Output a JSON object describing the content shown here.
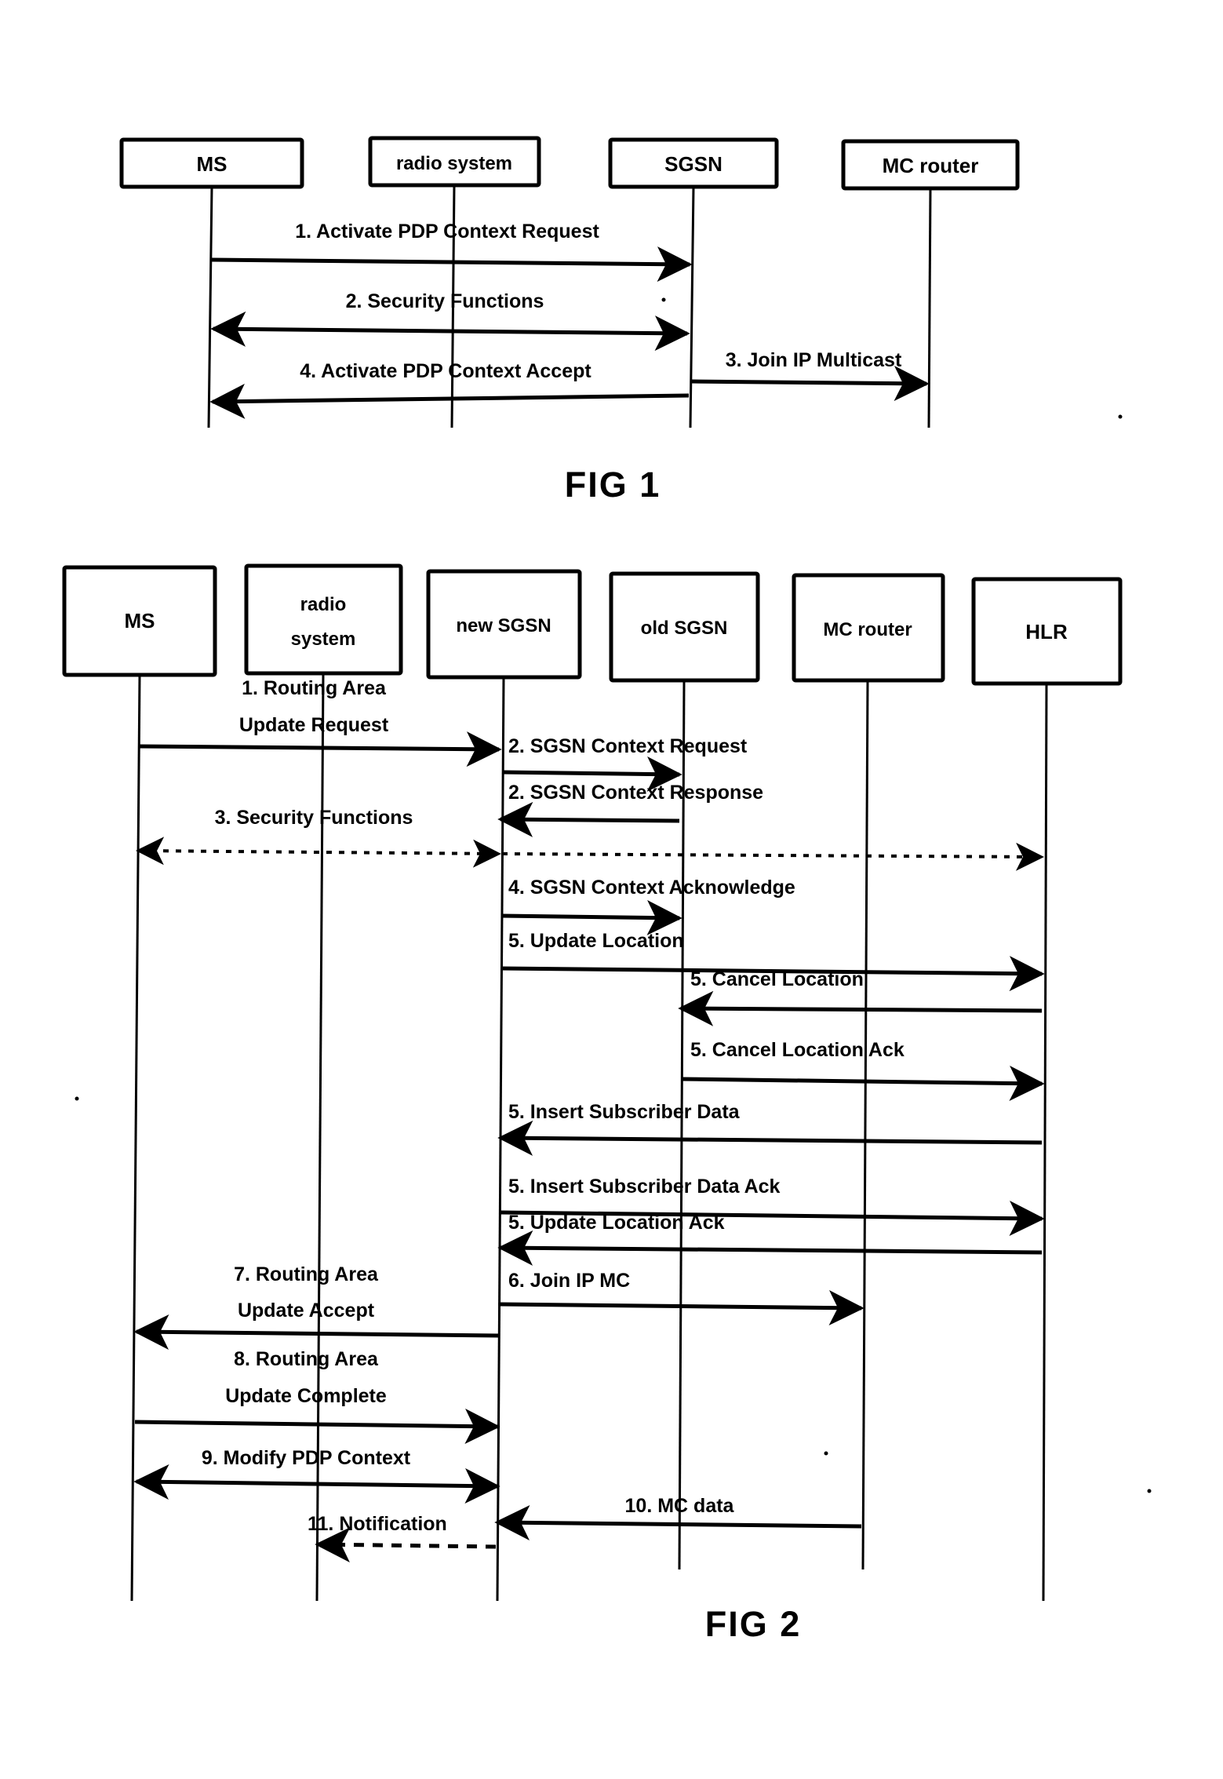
{
  "document": {
    "kind": "patent-sequence-diagrams",
    "figures": [
      {
        "id": "fig1",
        "caption": "FIG 1",
        "lanes": [
          {
            "key": "ms",
            "label": "MS"
          },
          {
            "key": "radio",
            "label": "radio system"
          },
          {
            "key": "sgsn",
            "label": "SGSN"
          },
          {
            "key": "mc_router",
            "label": "MC router"
          }
        ],
        "messages": [
          {
            "num": "1",
            "label": "1. Activate PDP Context Request",
            "from": "ms",
            "to": "sgsn",
            "style": "solid",
            "direction": "right"
          },
          {
            "num": "2",
            "label": "2. Security Functions",
            "from": "ms",
            "to": "sgsn",
            "style": "solid",
            "direction": "both"
          },
          {
            "num": "3",
            "label": "3. Join IP Multicast",
            "from": "sgsn",
            "to": "mc_router",
            "style": "solid",
            "direction": "right"
          },
          {
            "num": "4",
            "label": "4. Activate PDP Context Accept",
            "from": "sgsn",
            "to": "ms",
            "style": "solid",
            "direction": "left"
          }
        ]
      },
      {
        "id": "fig2",
        "caption": "FIG 2",
        "lanes": [
          {
            "key": "ms",
            "label": "MS"
          },
          {
            "key": "radio",
            "label": "radio\nsystem"
          },
          {
            "key": "new_sgsn",
            "label": "new SGSN"
          },
          {
            "key": "old_sgsn",
            "label": "old SGSN"
          },
          {
            "key": "mc_router",
            "label": "MC router"
          },
          {
            "key": "hlr",
            "label": "HLR"
          }
        ],
        "messages": [
          {
            "num": "1",
            "label": "1. Routing  Area\nUpdate Request",
            "from": "ms",
            "to": "new_sgsn",
            "style": "solid",
            "direction": "right"
          },
          {
            "num": "2a",
            "label": "2. SGSN Context Request",
            "from": "new_sgsn",
            "to": "old_sgsn",
            "style": "solid",
            "direction": "right"
          },
          {
            "num": "2b",
            "label": "2. SGSN Context Response",
            "from": "old_sgsn",
            "to": "new_sgsn",
            "style": "solid",
            "direction": "left"
          },
          {
            "num": "3",
            "label": "3. Security Functions",
            "from": "ms",
            "to": "hlr",
            "style": "dotted",
            "direction": "both"
          },
          {
            "num": "4",
            "label": "4. SGSN Context Acknowledge",
            "from": "new_sgsn",
            "to": "old_sgsn",
            "style": "solid",
            "direction": "right"
          },
          {
            "num": "5a",
            "label": "5. Update Location",
            "from": "new_sgsn",
            "to": "hlr",
            "style": "solid",
            "direction": "right"
          },
          {
            "num": "5b",
            "label": "5. Cancel Location",
            "from": "hlr",
            "to": "old_sgsn",
            "style": "solid",
            "direction": "left"
          },
          {
            "num": "5c",
            "label": "5. Cancel Location Ack",
            "from": "old_sgsn",
            "to": "hlr",
            "style": "solid",
            "direction": "right"
          },
          {
            "num": "5d",
            "label": "5. Insert Subscriber Data",
            "from": "hlr",
            "to": "new_sgsn",
            "style": "solid",
            "direction": "left"
          },
          {
            "num": "5e",
            "label": "5. Insert Subscriber Data Ack",
            "from": "new_sgsn",
            "to": "hlr",
            "style": "solid",
            "direction": "right"
          },
          {
            "num": "5f",
            "label": "5. Update Location Ack",
            "from": "hlr",
            "to": "new_sgsn",
            "style": "solid",
            "direction": "left"
          },
          {
            "num": "6",
            "label": "6. Join IP MC",
            "from": "new_sgsn",
            "to": "mc_router",
            "style": "solid",
            "direction": "right"
          },
          {
            "num": "7",
            "label": "7. Routing  Area\nUpdate Accept",
            "from": "new_sgsn",
            "to": "ms",
            "style": "solid",
            "direction": "left"
          },
          {
            "num": "8",
            "label": "8. Routing  Area\nUpdate Complete",
            "from": "ms",
            "to": "new_sgsn",
            "style": "solid",
            "direction": "right"
          },
          {
            "num": "9",
            "label": "9. Modify PDP Context",
            "from": "ms",
            "to": "new_sgsn",
            "style": "solid",
            "direction": "both"
          },
          {
            "num": "10",
            "label": "10. MC data",
            "from": "mc_router",
            "to": "new_sgsn",
            "style": "solid",
            "direction": "left"
          },
          {
            "num": "11",
            "label": "11. Notification",
            "from": "new_sgsn",
            "to": "radio",
            "style": "dashed",
            "direction": "left"
          }
        ]
      }
    ]
  },
  "fig1": {
    "caption": "FIG 1",
    "lanes": {
      "ms": "MS",
      "radio": "radio system",
      "sgsn": "SGSN",
      "mc_router": "MC router"
    },
    "msg": {
      "m1": "1. Activate PDP Context Request",
      "m2": "2. Security Functions",
      "m3": "3. Join IP Multicast",
      "m4": "4. Activate PDP Context Accept"
    }
  },
  "fig2": {
    "caption": "FIG 2",
    "lanes": {
      "ms": "MS",
      "radio_l1": "radio",
      "radio_l2": "system",
      "new_sgsn": "new SGSN",
      "old_sgsn": "old SGSN",
      "mc_router": "MC router",
      "hlr": "HLR"
    },
    "msg": {
      "m1_l1": "1. Routing  Area",
      "m1_l2": "Update Request",
      "m2a": "2. SGSN Context Request",
      "m2b": "2. SGSN Context Response",
      "m3": "3. Security Functions",
      "m4": "4. SGSN Context Acknowledge",
      "m5a": "5. Update Location",
      "m5b": "5. Cancel Location",
      "m5c": "5. Cancel Location Ack",
      "m5d": "5. Insert Subscriber Data",
      "m5e": "5. Insert Subscriber Data Ack",
      "m5f": "5. Update Location Ack",
      "m6": "6. Join IP MC",
      "m7_l1": "7. Routing  Area",
      "m7_l2": "Update Accept",
      "m8_l1": "8. Routing  Area",
      "m8_l2": "Update Complete",
      "m9": "9. Modify PDP Context",
      "m10": "10. MC data",
      "m11": "11. Notification"
    }
  },
  "colors": {
    "ink": "#000000",
    "paper": "#ffffff"
  }
}
